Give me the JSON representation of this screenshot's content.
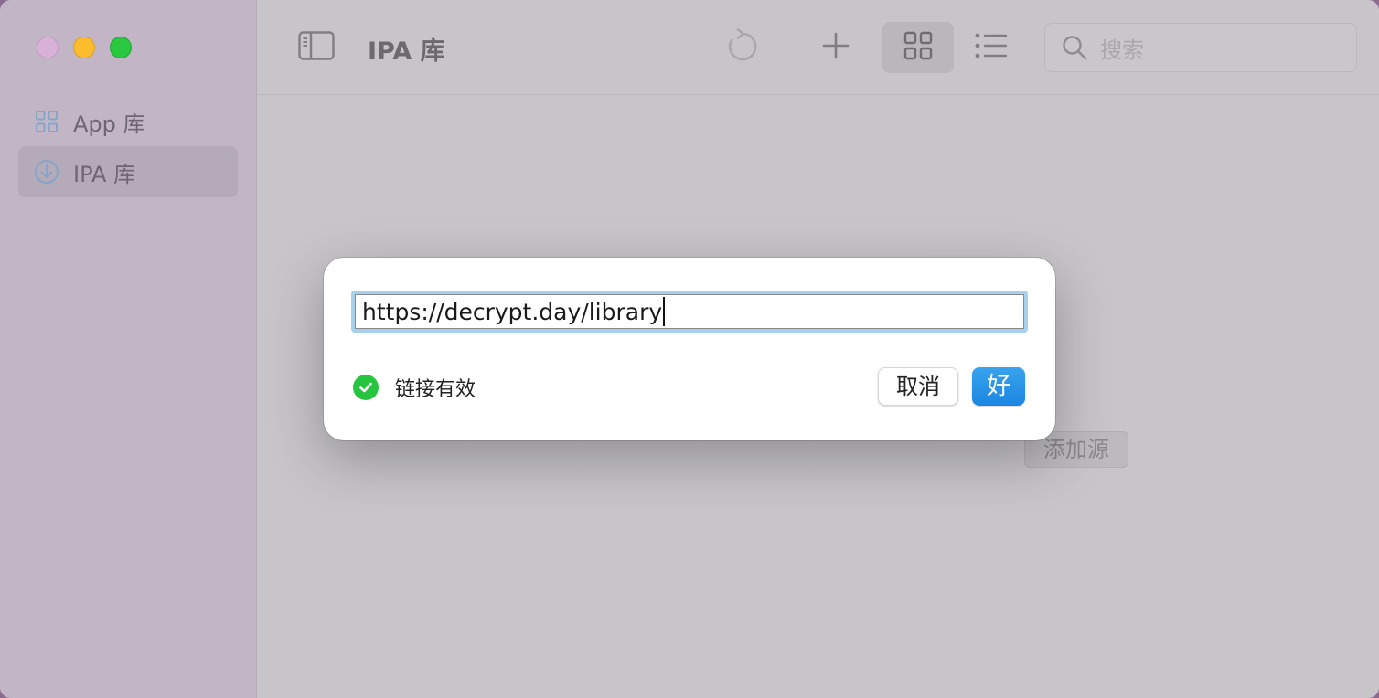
{
  "window": {
    "traffic_lights": [
      "close",
      "minimize",
      "maximize"
    ]
  },
  "sidebar": {
    "items": [
      {
        "label": "App 库",
        "icon": "grid-icon",
        "selected": false
      },
      {
        "label": "IPA 库",
        "icon": "download-circle-icon",
        "selected": true
      }
    ]
  },
  "toolbar": {
    "title": "IPA 库",
    "buttons": [
      "sidebar-toggle-icon",
      "refresh-icon",
      "plus-icon",
      "grid-view-icon",
      "list-view-icon"
    ],
    "search": {
      "placeholder": "搜索",
      "value": ""
    }
  },
  "main": {
    "add_source_label": "添加源"
  },
  "dialog": {
    "url_value": "https://decrypt.day/library",
    "status_text": "链接有效",
    "status_icon": "check-circle-icon",
    "cancel_label": "取消",
    "ok_label": "好"
  },
  "colors": {
    "accent": "#1f8ee6",
    "valid_green": "#27c53f",
    "sidebar_bg": "#c2b5c6"
  }
}
